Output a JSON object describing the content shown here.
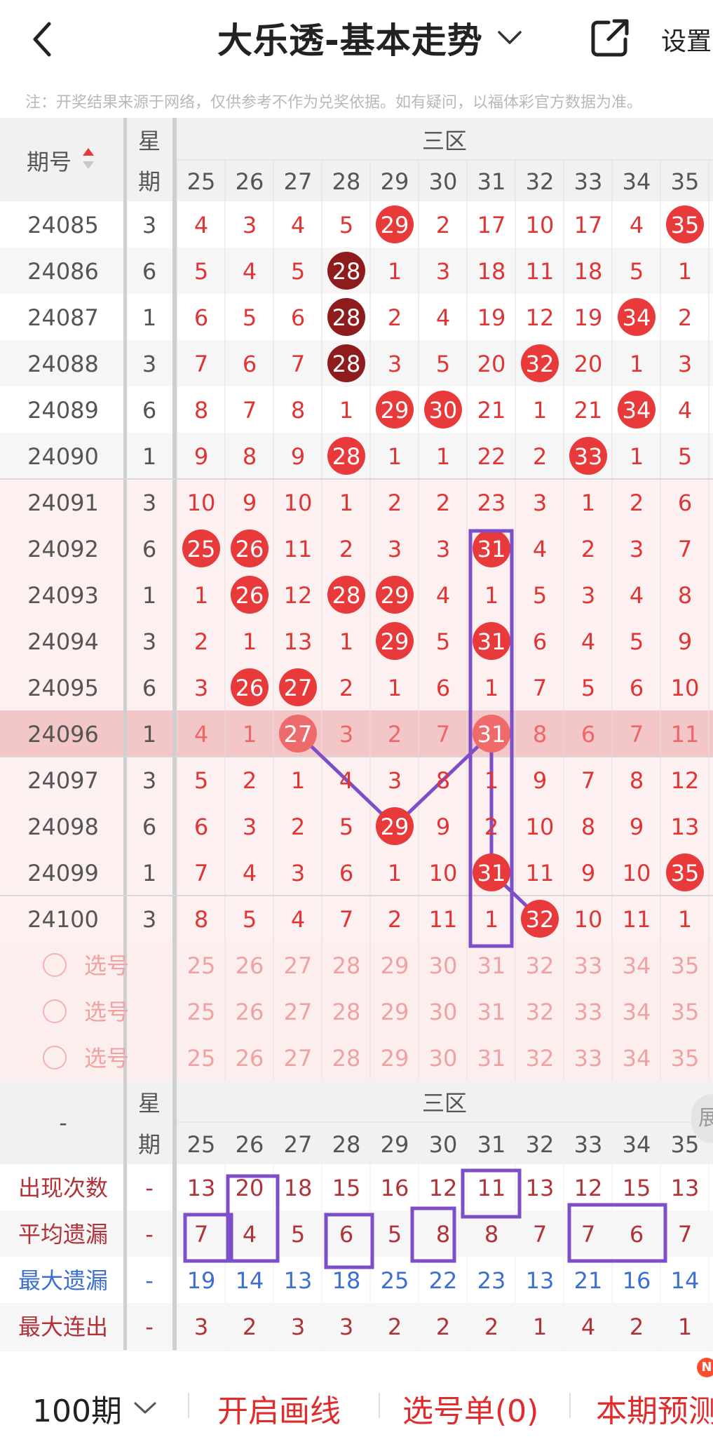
{
  "header": {
    "title": "大乐透-基本走势",
    "settings_label": "设置",
    "notice": "注：开奖结果来源于网络，仅供参考不作为兑奖依据。如有疑问，以福体彩官方数据为准。"
  },
  "table": {
    "issue_header": "期号",
    "week_header_top": "星",
    "week_header_bottom": "期",
    "zone_label": "三区",
    "columns": [
      "25",
      "26",
      "27",
      "28",
      "29",
      "30",
      "31",
      "32",
      "33",
      "34",
      "35"
    ],
    "rows": [
      {
        "issue": "24085",
        "week": "3",
        "cells": [
          "4",
          "3",
          "4",
          "5",
          "29",
          "2",
          "17",
          "10",
          "17",
          "4",
          "35"
        ],
        "hits": [
          4,
          10
        ]
      },
      {
        "issue": "24086",
        "week": "6",
        "cells": [
          "5",
          "4",
          "5",
          "28",
          "1",
          "3",
          "18",
          "11",
          "18",
          "5",
          "1"
        ],
        "hits": [
          3
        ]
      },
      {
        "issue": "24087",
        "week": "1",
        "cells": [
          "6",
          "5",
          "6",
          "28",
          "2",
          "4",
          "19",
          "12",
          "19",
          "34",
          "2"
        ],
        "hits": [
          3,
          9
        ]
      },
      {
        "issue": "24088",
        "week": "3",
        "cells": [
          "7",
          "6",
          "7",
          "28",
          "3",
          "5",
          "20",
          "32",
          "20",
          "1",
          "3"
        ],
        "hits": [
          3,
          7
        ]
      },
      {
        "issue": "24089",
        "week": "6",
        "cells": [
          "8",
          "7",
          "8",
          "1",
          "29",
          "30",
          "21",
          "1",
          "21",
          "34",
          "4"
        ],
        "hits": [
          4,
          5,
          9
        ]
      },
      {
        "issue": "24090",
        "week": "1",
        "cells": [
          "9",
          "8",
          "9",
          "28",
          "1",
          "1",
          "22",
          "2",
          "33",
          "1",
          "5"
        ],
        "hits": [
          3,
          8
        ]
      },
      {
        "issue": "24091",
        "week": "3",
        "cells": [
          "10",
          "9",
          "10",
          "1",
          "2",
          "2",
          "23",
          "3",
          "1",
          "2",
          "6"
        ],
        "hits": []
      },
      {
        "issue": "24092",
        "week": "6",
        "cells": [
          "25",
          "26",
          "11",
          "2",
          "3",
          "3",
          "31",
          "4",
          "2",
          "3",
          "7"
        ],
        "hits": [
          0,
          1,
          6
        ]
      },
      {
        "issue": "24093",
        "week": "1",
        "cells": [
          "1",
          "26",
          "12",
          "28",
          "29",
          "4",
          "1",
          "5",
          "3",
          "4",
          "8"
        ],
        "hits": [
          1,
          3,
          4
        ]
      },
      {
        "issue": "24094",
        "week": "3",
        "cells": [
          "2",
          "1",
          "13",
          "1",
          "29",
          "5",
          "31",
          "6",
          "4",
          "5",
          "9"
        ],
        "hits": [
          4,
          6
        ]
      },
      {
        "issue": "24095",
        "week": "6",
        "cells": [
          "3",
          "26",
          "27",
          "2",
          "1",
          "6",
          "1",
          "7",
          "5",
          "6",
          "10"
        ],
        "hits": [
          1,
          2
        ]
      },
      {
        "issue": "24096",
        "week": "1",
        "cells": [
          "4",
          "1",
          "27",
          "3",
          "2",
          "7",
          "31",
          "8",
          "6",
          "7",
          "11"
        ],
        "hits": [
          2,
          6
        ]
      },
      {
        "issue": "24097",
        "week": "3",
        "cells": [
          "5",
          "2",
          "1",
          "4",
          "3",
          "8",
          "1",
          "9",
          "7",
          "8",
          "12"
        ],
        "hits": []
      },
      {
        "issue": "24098",
        "week": "6",
        "cells": [
          "6",
          "3",
          "2",
          "5",
          "29",
          "9",
          "2",
          "10",
          "8",
          "9",
          "13"
        ],
        "hits": [
          4
        ]
      },
      {
        "issue": "24099",
        "week": "1",
        "cells": [
          "7",
          "4",
          "3",
          "6",
          "1",
          "10",
          "31",
          "11",
          "9",
          "10",
          "35"
        ],
        "hits": [
          6,
          10
        ]
      },
      {
        "issue": "24100",
        "week": "3",
        "cells": [
          "8",
          "5",
          "4",
          "7",
          "2",
          "11",
          "1",
          "32",
          "10",
          "11",
          "1"
        ],
        "hits": [
          7
        ]
      }
    ],
    "select_label": "选号",
    "dash": "-",
    "stats": [
      {
        "label": "出现次数",
        "color": "#b0333a",
        "values": [
          "13",
          "20",
          "18",
          "15",
          "16",
          "12",
          "11",
          "13",
          "12",
          "15",
          "13"
        ]
      },
      {
        "label": "平均遗漏",
        "color": "#b0333a",
        "values": [
          "7",
          "4",
          "5",
          "6",
          "5",
          "8",
          "8",
          "7",
          "7",
          "6",
          "7"
        ]
      },
      {
        "label": "最大遗漏",
        "color": "#3d6fd1",
        "values": [
          "19",
          "14",
          "13",
          "18",
          "25",
          "22",
          "23",
          "13",
          "21",
          "16",
          "14"
        ]
      },
      {
        "label": "最大连出",
        "color": "#b0333a",
        "values": [
          "3",
          "2",
          "3",
          "3",
          "2",
          "2",
          "2",
          "1",
          "4",
          "2",
          "1"
        ]
      }
    ]
  },
  "colors": {
    "accent": "#e83a3a",
    "dark_ball": "#8e1c1c",
    "annotation": "#7c4ec9",
    "highlight_row": "#f3c7c7"
  },
  "bottom_bar": {
    "periods": "100期",
    "draw_lines": "开启画线",
    "pick_list": "选号单(0)",
    "predict": "本期预测",
    "badge": "N"
  },
  "side_handle": "展"
}
